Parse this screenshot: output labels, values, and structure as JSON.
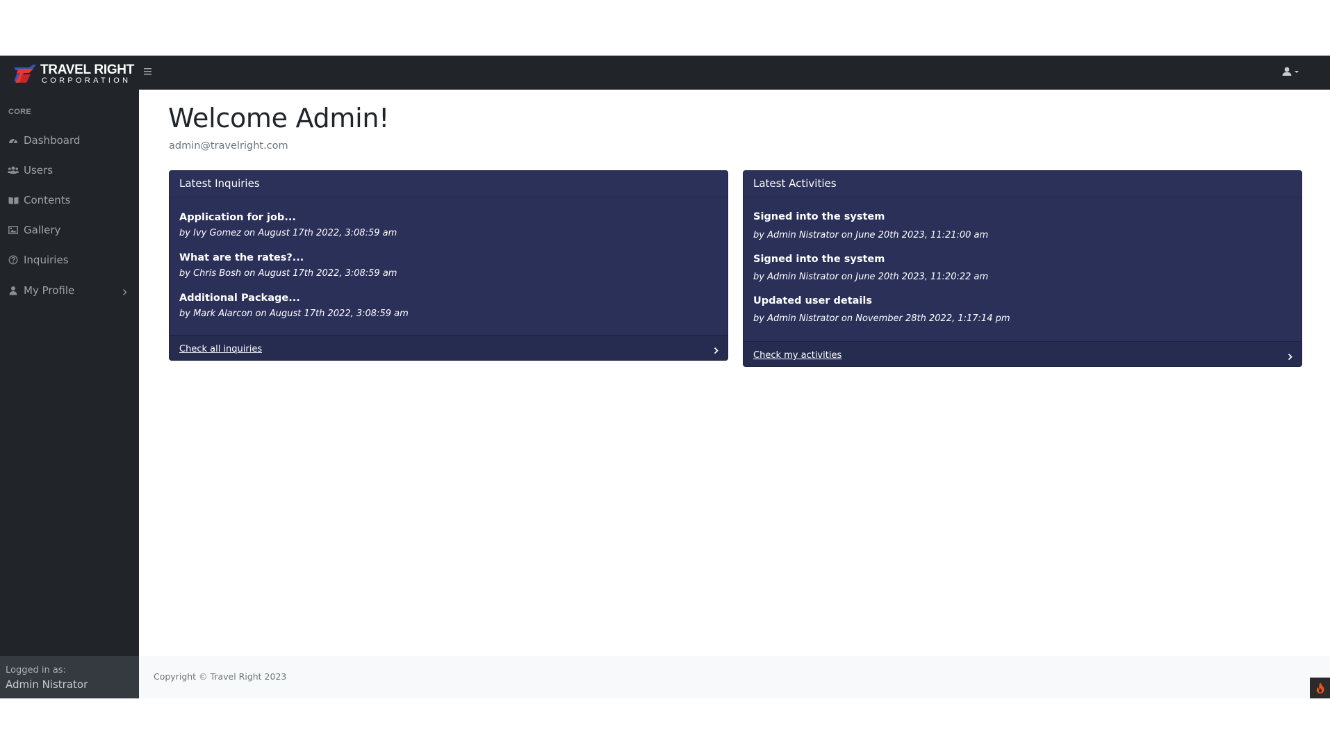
{
  "brand": {
    "line1": "TRAVEL RIGHT",
    "line2": "CORPORATION",
    "accent_red": "#e53935",
    "accent_blue": "#3f51b5"
  },
  "navbar": {
    "menu_icon": "hamburger-icon",
    "user_icon": "user-icon"
  },
  "sidebar": {
    "heading": "CORE",
    "items": [
      {
        "label": "Dashboard",
        "icon": "tachometer-icon"
      },
      {
        "label": "Users",
        "icon": "users-icon"
      },
      {
        "label": "Contents",
        "icon": "book-icon"
      },
      {
        "label": "Gallery",
        "icon": "image-icon"
      },
      {
        "label": "Inquiries",
        "icon": "question-circle-icon"
      },
      {
        "label": "My Profile",
        "icon": "user-icon"
      }
    ],
    "footer": {
      "logged_in_label": "Logged in as:",
      "user_name": "Admin Nistrator"
    }
  },
  "main": {
    "welcome": "Welcome Admin!",
    "email": "admin@travelright.com",
    "inquiries": {
      "header": "Latest Inquiries",
      "items": [
        {
          "title": "Application for job...",
          "meta": "by Ivy Gomez on August 17th 2022, 3:08:59 am"
        },
        {
          "title": "What are the rates?...",
          "meta": "by Chris Bosh on August 17th 2022, 3:08:59 am"
        },
        {
          "title": "Additional Package...",
          "meta": "by Mark Alarcon on August 17th 2022, 3:08:59 am"
        }
      ],
      "footer_link": "Check all inquiries"
    },
    "activities": {
      "header": "Latest Activities",
      "items": [
        {
          "title": "Signed into the system",
          "meta": "by Admin Nistrator on June 20th 2023, 11:21:00 am"
        },
        {
          "title": "Signed into the system",
          "meta": "by Admin Nistrator on June 20th 2023, 11:20:22 am"
        },
        {
          "title": "Updated user details",
          "meta": "by Admin Nistrator on November 28th 2022, 1:17:14 pm"
        }
      ],
      "footer_link": "Check my activities"
    }
  },
  "footer": {
    "copyright": "Copyright © Travel Right 2023"
  },
  "colors": {
    "dark": "#212529",
    "card": "#2a3058",
    "fire": "#e8541e"
  }
}
